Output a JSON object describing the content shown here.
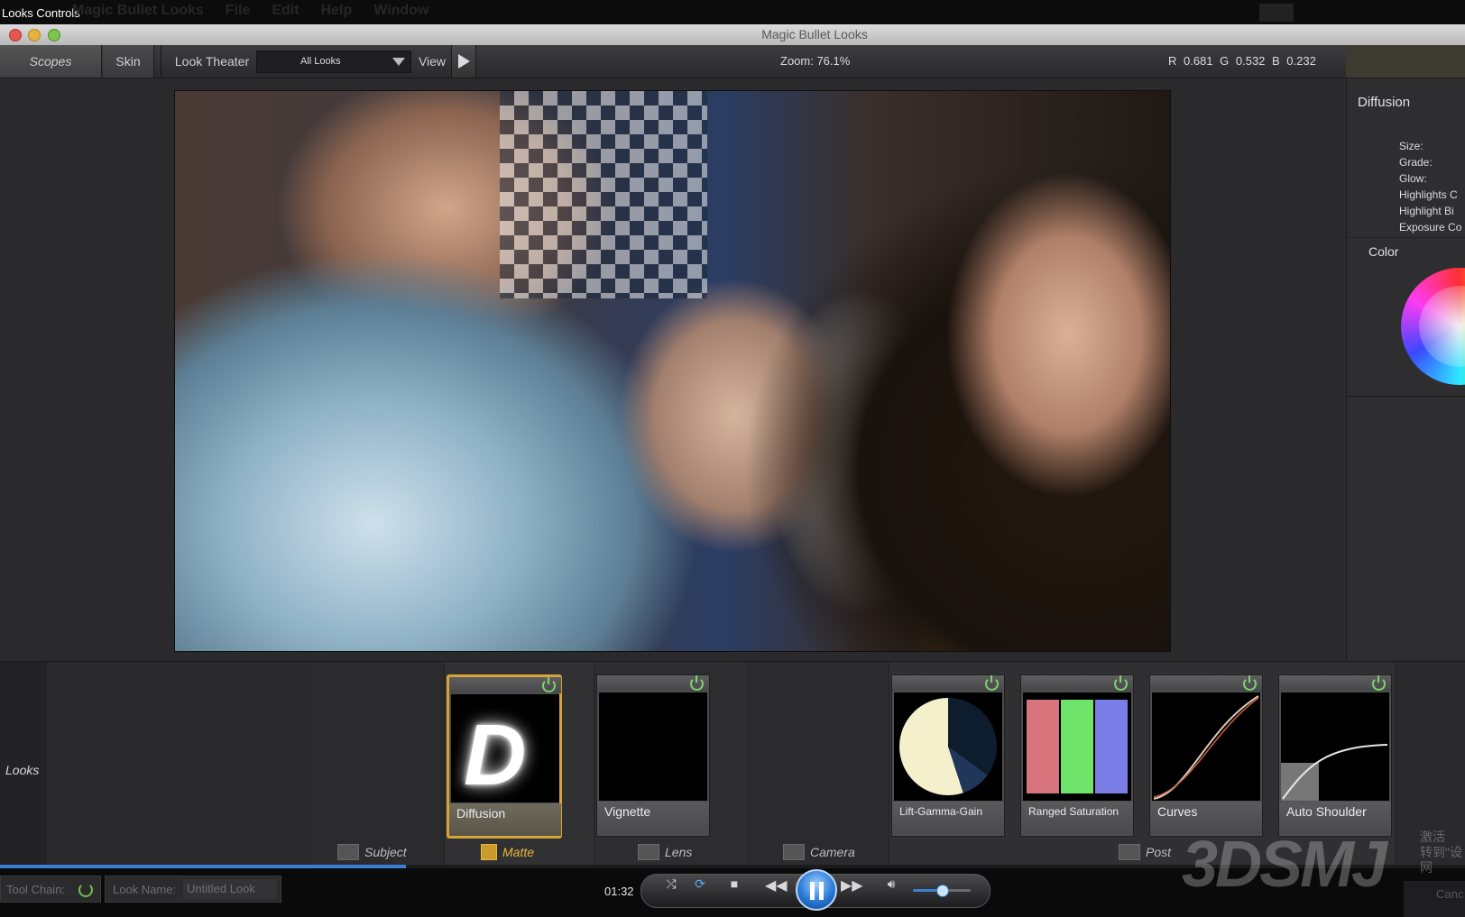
{
  "system": {
    "app_title": "Looks Controls",
    "menu": [
      "Magic Bullet Looks",
      "File",
      "Edit",
      "Help",
      "Window"
    ]
  },
  "window": {
    "title": "Magic Bullet Looks"
  },
  "toolbar": {
    "scopes": "Scopes",
    "skin": "Skin",
    "look_theater": "Look Theater",
    "theater_selected": "All Looks",
    "view": "View",
    "zoom": "Zoom:  76.1%",
    "rgb": "R 0.681   G 0.532   B 0.232"
  },
  "right_panel": {
    "title": "Diffusion",
    "params": [
      "Size:",
      "Grade:",
      "Glow:",
      "Highlights C",
      "Highlight Bi",
      "Exposure Co"
    ],
    "color_title": "Color"
  },
  "looks": {
    "side_label": "Looks",
    "stages": [
      "Subject",
      "Matte",
      "Lens",
      "Camera",
      "Post"
    ],
    "tools": {
      "diffusion": "Diffusion",
      "vignette": "Vignette",
      "lgg": "Lift-Gamma-Gain",
      "ranged_saturation": "Ranged Saturation",
      "curves": "Curves",
      "auto_shoulder": "Auto Shoulder"
    },
    "diffusion_glyph": "D",
    "ranged_saturation_colors": [
      "#d8747c",
      "#6fe36a",
      "#7b7de6"
    ],
    "accent": "#d6a43a",
    "power_color": "#7ed36b"
  },
  "bottom": {
    "tool_chain": "Tool Chain:",
    "look_name_label": "Look Name:",
    "look_name": "Untitled Look",
    "time": "01:32",
    "right_hint": "Canc",
    "progress": 0.277,
    "volume": 0.5
  },
  "watermark": {
    "text": "3DSMJ",
    "small": "激活\n转到\"设\n网"
  }
}
